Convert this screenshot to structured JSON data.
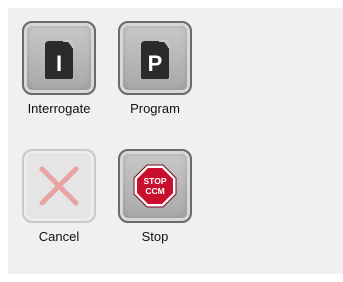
{
  "toolbar": {
    "interrogate": {
      "label": "Interrogate",
      "icon": "device-interrogate-icon",
      "glyph": "I"
    },
    "program": {
      "label": "Program",
      "icon": "device-program-icon",
      "glyph": "P"
    },
    "cancel": {
      "label": "Cancel",
      "icon": "cancel-x-icon",
      "enabled": false
    },
    "stop": {
      "label": "Stop",
      "icon": "stop-ccm-icon",
      "sign_line1": "STOP",
      "sign_line2": "CCM"
    }
  },
  "colors": {
    "icon_dark": "#2b2b2b",
    "cancel_x": "#e8a3a3",
    "stop_red": "#c8102e"
  }
}
